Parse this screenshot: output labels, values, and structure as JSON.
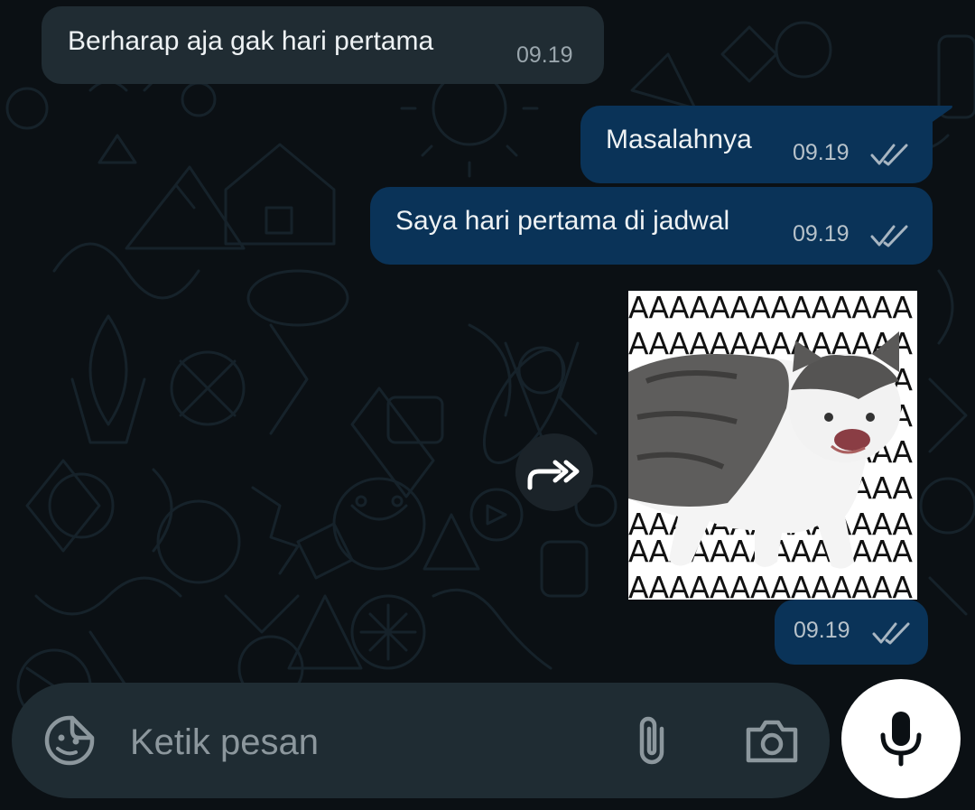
{
  "messages": [
    {
      "direction": "incoming",
      "text": "Berharap aja gak hari pertama",
      "time": "09.19"
    },
    {
      "direction": "outgoing",
      "text": "Masalahnya",
      "time": "09.19",
      "status": "read"
    },
    {
      "direction": "outgoing",
      "text": "Saya hari pertama di jadwal",
      "time": "09.19",
      "status": "read"
    },
    {
      "direction": "outgoing",
      "type": "sticker",
      "sticker_text": "AAAAAAAAAAAAAA",
      "time": "09.19",
      "status": "read"
    }
  ],
  "composer": {
    "placeholder": "Ketik pesan",
    "icons": [
      "sticker-icon",
      "paperclip-icon",
      "camera-icon",
      "microphone-icon"
    ]
  },
  "forward_icon": "forward-icon",
  "colors": {
    "background": "#0b1014",
    "incoming_bubble": "#202c33",
    "outgoing_bubble": "#0a3358",
    "input_bar": "#1f2c33",
    "mic_button": "#ffffff"
  }
}
